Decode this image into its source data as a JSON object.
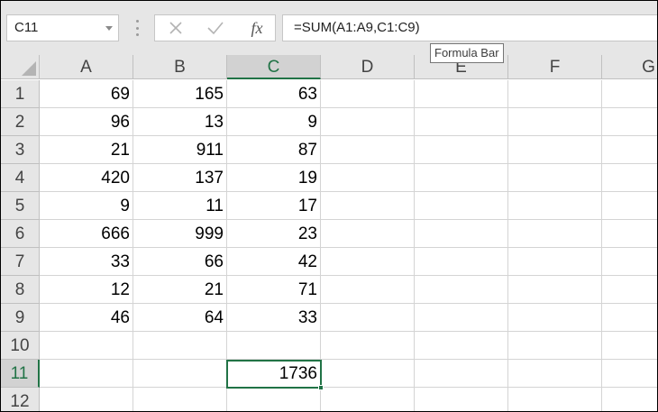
{
  "name_box": {
    "value": "C11"
  },
  "formula_bar": {
    "formula": "=SUM(A1:A9,C1:C9)",
    "fx_label": "fx",
    "tooltip": "Formula Bar"
  },
  "columns": [
    "A",
    "B",
    "C",
    "D",
    "E",
    "F",
    "G"
  ],
  "rows": [
    "1",
    "2",
    "3",
    "4",
    "5",
    "6",
    "7",
    "8",
    "9",
    "10",
    "11",
    "12"
  ],
  "cells": [
    [
      "69",
      "165",
      "63"
    ],
    [
      "96",
      "13",
      "9"
    ],
    [
      "21",
      "911",
      "87"
    ],
    [
      "420",
      "137",
      "19"
    ],
    [
      "9",
      "11",
      "17"
    ],
    [
      "666",
      "999",
      "23"
    ],
    [
      "33",
      "66",
      "42"
    ],
    [
      "12",
      "21",
      "71"
    ],
    [
      "46",
      "64",
      "33"
    ],
    [
      "",
      "",
      ""
    ],
    [
      "",
      "",
      "1736"
    ],
    [
      "",
      "",
      ""
    ]
  ],
  "selection": {
    "column": "C",
    "row": "11"
  },
  "colors": {
    "accent": "#217346",
    "header_bg": "#e6e6e6",
    "gridline": "#d4d4d4"
  },
  "icons": [
    "cancel-icon",
    "enter-check-icon",
    "insert-function-icon",
    "dropdown-arrow-icon"
  ]
}
